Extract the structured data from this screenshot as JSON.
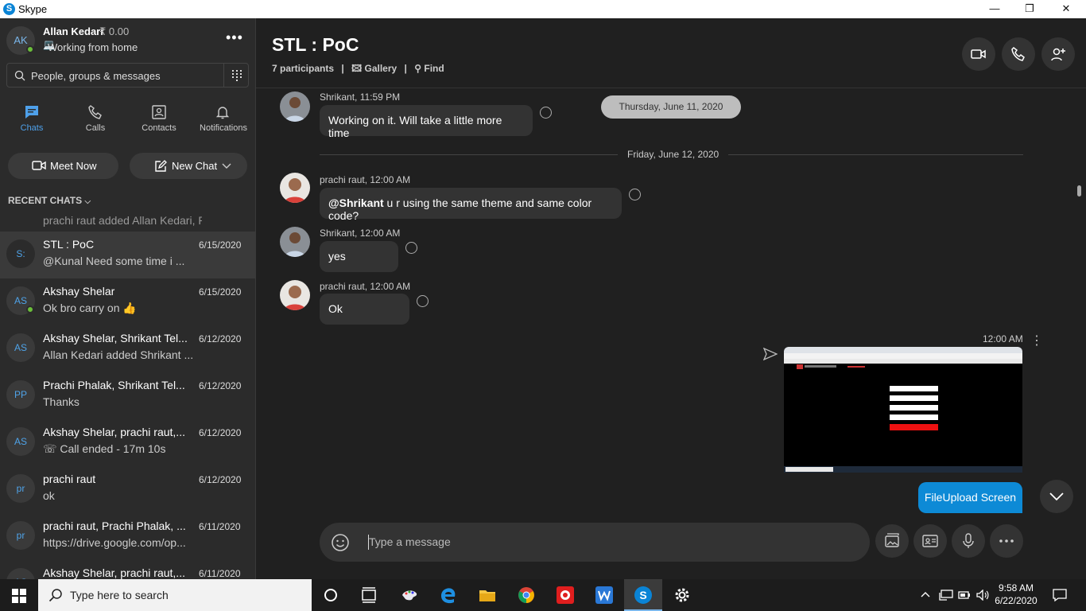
{
  "window": {
    "title": "Skype",
    "logo_letter": "S",
    "minimize": "—",
    "maximize": "❐",
    "close": "✕"
  },
  "profile": {
    "initials": "AK",
    "name": "Allan Kedari",
    "credit": "₹ 0.00",
    "status": "Working from home",
    "more": "•••"
  },
  "search": {
    "placeholder": "People, groups & messages"
  },
  "nav": {
    "chats": "Chats",
    "calls": "Calls",
    "contacts": "Contacts",
    "notifications": "Notifications"
  },
  "actions": {
    "meet_now": "Meet Now",
    "new_chat": "New Chat"
  },
  "recent_label": "RECENT CHATS",
  "chats": [
    {
      "initials": "",
      "name": "",
      "date": "",
      "preview": "prachi raut added Allan Kedari, Pri..."
    },
    {
      "initials": "S:",
      "name": "STL : PoC",
      "date": "6/15/2020",
      "preview": "@Kunal  Need some time i ..."
    },
    {
      "initials": "AS",
      "name": "Akshay Shelar",
      "date": "6/15/2020",
      "preview": "Ok bro carry on 👍"
    },
    {
      "initials": "AS",
      "name": "Akshay Shelar, Shrikant Tel...",
      "date": "6/12/2020",
      "preview": "Allan Kedari added Shrikant ..."
    },
    {
      "initials": "PP",
      "name": "Prachi Phalak, Shrikant Tel...",
      "date": "6/12/2020",
      "preview": "Thanks"
    },
    {
      "initials": "AS",
      "name": "Akshay Shelar, prachi raut,...",
      "date": "6/12/2020",
      "preview": "☏ Call ended - 17m 10s"
    },
    {
      "initials": "pr",
      "name": "prachi raut",
      "date": "6/12/2020",
      "preview": "ok"
    },
    {
      "initials": "pr",
      "name": "prachi raut, Prachi Phalak, ...",
      "date": "6/11/2020",
      "preview": "https://drive.google.com/op..."
    },
    {
      "initials": "AS",
      "name": "Akshay Shelar, prachi raut,...",
      "date": "6/11/2020",
      "preview": ""
    }
  ],
  "conversation": {
    "title": "STL : PoC",
    "participants": "7 participants",
    "sep": "|",
    "gallery": "Gallery",
    "find": "Find",
    "date_pill": "Thursday, June 11, 2020",
    "date_sep": "Friday, June 12, 2020",
    "messages": [
      {
        "sender": "Shrikant, 11:59 PM",
        "text": "Working on it. Will take a little more time"
      },
      {
        "sender": "prachi raut, 12:00 AM",
        "mention": "@Shrikant",
        "text": " u r using the same theme and same color code?"
      },
      {
        "sender": "Shrikant, 12:00 AM",
        "text": "yes"
      },
      {
        "sender": "prachi raut, 12:00 AM",
        "text": "Ok"
      }
    ],
    "sent_time": "12:00 AM",
    "sent_caption": "FileUpload Screen",
    "kebab": "⋮"
  },
  "composer": {
    "placeholder": "Type a message"
  },
  "taskbar": {
    "search": "Type here to search",
    "time": "9:58 AM",
    "date": "6/22/2020"
  },
  "colors": {
    "accent": "#0d8ad6",
    "online": "#6bbf3a",
    "bg": "#202020",
    "sidebar": "#2b2b2b"
  }
}
